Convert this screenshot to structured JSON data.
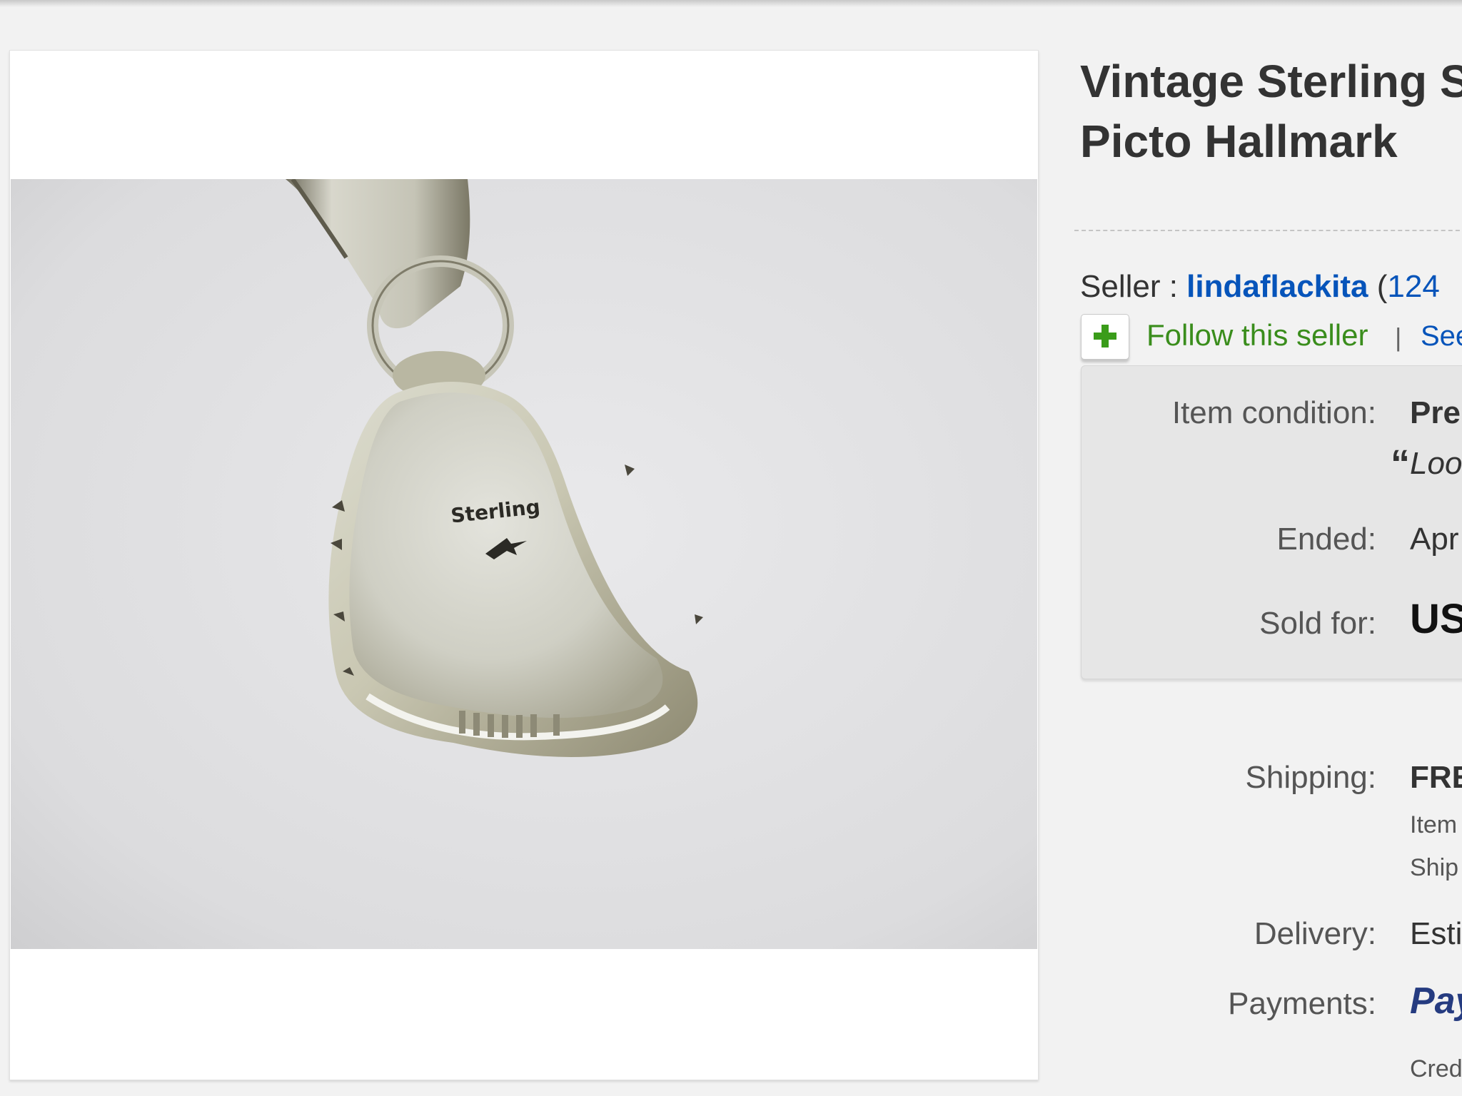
{
  "listing": {
    "title_line1": "Vintage Sterling S",
    "title_line2": "Picto Hallmark"
  },
  "seller": {
    "label": "Seller : ",
    "name": "lindaflackita",
    "feedback_open": " (",
    "feedback_count": "124"
  },
  "follow": {
    "label": "Follow this seller",
    "separator": "|",
    "see_link": "See"
  },
  "details": {
    "condition_label": "Item condition:",
    "condition_value": "Pre",
    "condition_quote_mark": "“",
    "condition_quote": "Loo",
    "ended_label": "Ended:",
    "ended_value": "Apr",
    "sold_label": "Sold for:",
    "sold_value": "US"
  },
  "shipping": {
    "shipping_label": "Shipping:",
    "shipping_value": "FRE",
    "item_note": "Item",
    "ships_note": "Ship",
    "delivery_label": "Delivery:",
    "delivery_value": "Esti",
    "payments_label": "Payments:",
    "payments_value": "Pay",
    "credit_note": "Cred"
  },
  "photo": {
    "hallmark_text": "Sterling"
  },
  "colors": {
    "link_blue": "#0654ba",
    "follow_green": "#3a8d1c",
    "paypal_blue": "#253b80"
  },
  "icons": [
    "plus-icon",
    "paypal-logo"
  ]
}
